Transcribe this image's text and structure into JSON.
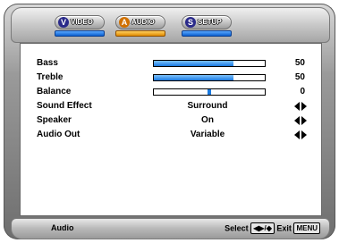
{
  "tabs": [
    {
      "badge": "V",
      "label": "VIDEO",
      "active": false
    },
    {
      "badge": "A",
      "label": "AUDIO",
      "active": true
    },
    {
      "badge": "S",
      "label": "SETUP",
      "active": false
    }
  ],
  "rows": {
    "bass": {
      "label": "Bass",
      "value": "50",
      "level_pct": 72
    },
    "treble": {
      "label": "Treble",
      "value": "50",
      "level_pct": 72
    },
    "balance": {
      "label": "Balance",
      "value": "0",
      "level_pct": 50
    },
    "sound_effect": {
      "label": "Sound Effect",
      "value": "Surround"
    },
    "speaker": {
      "label": "Speaker",
      "value": "On"
    },
    "audio_out": {
      "label": "Audio Out",
      "value": "Variable"
    }
  },
  "status": {
    "title": "Audio",
    "select_label": "Select",
    "select_keys": "◀▶/◆",
    "exit_label": "Exit",
    "exit_key": "MENU"
  },
  "colors": {
    "bar_fill": "#1a7ae0",
    "active_tab": "#e08a00",
    "inactive_tab": "#0a5fd0"
  }
}
